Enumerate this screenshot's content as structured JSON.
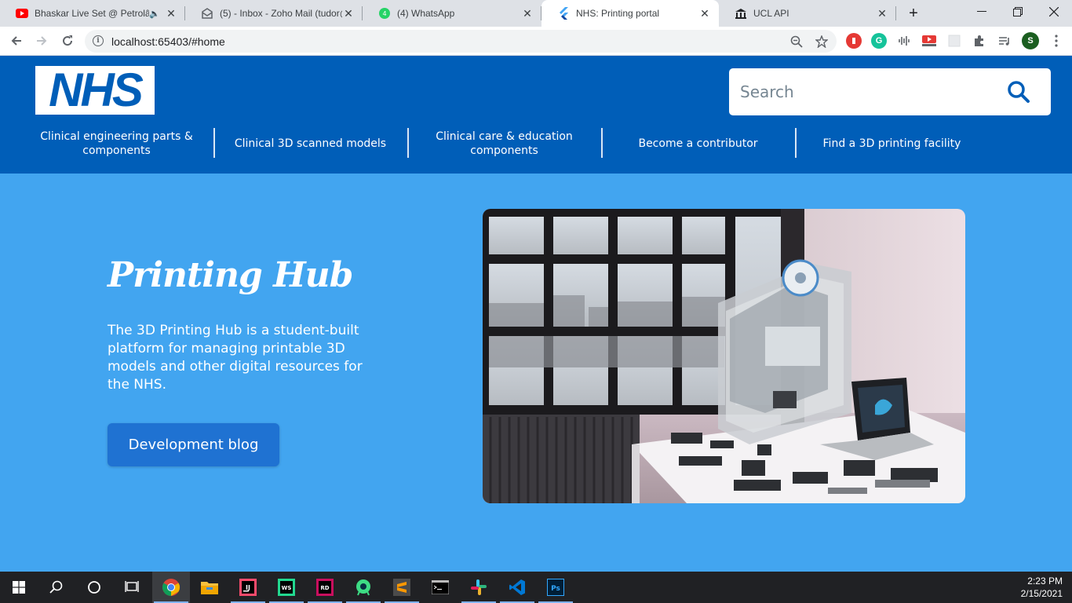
{
  "browser": {
    "tabs": [
      {
        "title": "Bhaskar Live Set @ Petrolâ",
        "icon": "youtube-icon",
        "audio": true
      },
      {
        "title": "(5) - Inbox - Zoho Mail (tudor@",
        "icon": "zoho-mail-icon"
      },
      {
        "title": "(4) WhatsApp",
        "icon": "whatsapp-icon"
      },
      {
        "title": "NHS: Printing portal",
        "icon": "flutter-icon",
        "active": true
      },
      {
        "title": "UCL API",
        "icon": "ucl-icon"
      }
    ],
    "url": "localhost:65403/#home"
  },
  "header": {
    "logo_text": "NHS",
    "search_placeholder": "Search",
    "nav": [
      "Clinical engineering parts & components",
      "Clinical 3D scanned models",
      "Clinical care & education components",
      "Become a contributor",
      "Find a 3D printing facility"
    ]
  },
  "hero": {
    "title": "Printing Hub",
    "description": "The 3D Printing Hub is a student-built platform for managing printable 3D models and other digital resources for the NHS.",
    "button_label": "Development blog",
    "image": "3d-printer-photo"
  },
  "taskbar": {
    "time": "2:23 PM",
    "date": "2/15/2021"
  },
  "colors": {
    "nhs_blue": "#005eb8",
    "hero_bg": "#42a5f0",
    "button_bg": "#1f72d2"
  }
}
